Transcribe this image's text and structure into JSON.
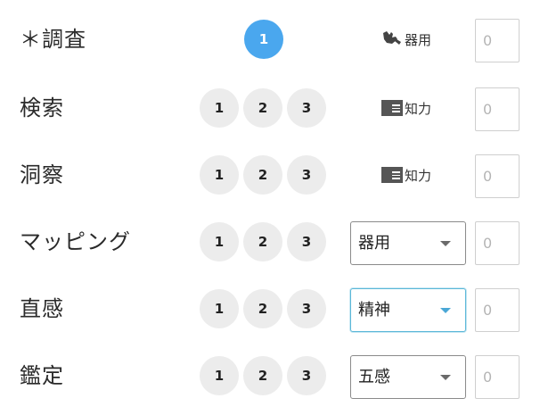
{
  "skills": [
    {
      "name": "＊調査",
      "levels": [
        "1"
      ],
      "attribute": "器用",
      "attribute_icon": "hand-icon",
      "value": "0"
    },
    {
      "name": "検索",
      "levels": [
        "1",
        "2",
        "3"
      ],
      "attribute": "知力",
      "attribute_icon": "book-icon",
      "value": "0"
    },
    {
      "name": "洞察",
      "levels": [
        "1",
        "2",
        "3"
      ],
      "attribute": "知力",
      "attribute_icon": "book-icon",
      "value": "0"
    },
    {
      "name": "マッピング",
      "levels": [
        "1",
        "2",
        "3"
      ],
      "attribute_select": "器用",
      "value": "0"
    },
    {
      "name": "直感",
      "levels": [
        "1",
        "2",
        "3"
      ],
      "attribute_select": "精神",
      "value": "0"
    },
    {
      "name": "鑑定",
      "levels": [
        "1",
        "2",
        "3"
      ],
      "attribute_select": "五感",
      "value": "0"
    }
  ],
  "colors": {
    "selected_level": "#4aa7ee",
    "level_bg": "#ececec",
    "focus_border": "#5ab7d8"
  }
}
